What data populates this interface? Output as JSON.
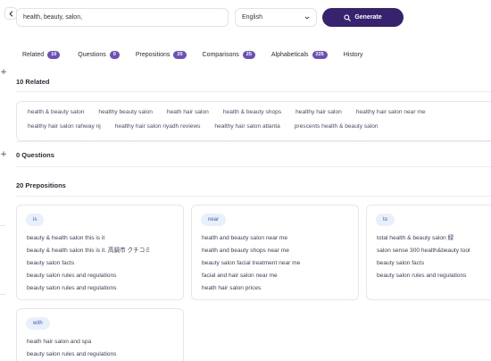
{
  "search": {
    "value": "health, beauty, salon,"
  },
  "language": {
    "selected": "English"
  },
  "generate": {
    "label": "Generate"
  },
  "tabs": [
    {
      "label": "Related",
      "count": "10"
    },
    {
      "label": "Questions",
      "count": "0"
    },
    {
      "label": "Prepositions",
      "count": "20"
    },
    {
      "label": "Comparisons",
      "count": "25"
    },
    {
      "label": "Alphabeticals",
      "count": "225"
    },
    {
      "label": "History",
      "count": ""
    }
  ],
  "sections": {
    "related_title": "10 Related",
    "questions_title": "0 Questions",
    "prepositions_title": "20 Prepositions"
  },
  "related": [
    "health & beauty salon",
    "healthy beauty salon",
    "heath hair salon",
    "health & beauty shops",
    "healthy hair salon",
    "healthy hair salon near me",
    "healthy hair salon rahway nj",
    "healthy hair salon riyadh reviews",
    "healthy hair salon atlanta",
    "prescents health & beauty salon"
  ],
  "prepositions": [
    {
      "label": "is",
      "items": [
        "beauty & health salon this is it",
        "beauty & health salon this is it. 高鍋市 クチコミ",
        "beauty salon facts",
        "beauty salon rules and regulations",
        "beauty salon rules and regulations"
      ]
    },
    {
      "label": "near",
      "items": [
        "health and beauty salon near me",
        "health and beauty shops near me",
        "beauty salon facial treatment near me",
        "facial and hair salon near me",
        "heath hair salon prices"
      ]
    },
    {
      "label": "to",
      "items": [
        "total health & beauty salon 緑",
        "salon sense 300 health&beauty tool",
        "beauty salon facts",
        "beauty salon rules and regulations"
      ]
    },
    {
      "label": "with",
      "items": [
        "heath hair salon and spa",
        "beauty salon rules and regulations"
      ]
    }
  ]
}
